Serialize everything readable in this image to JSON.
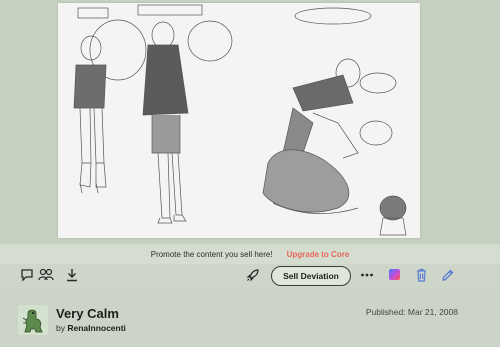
{
  "promo": {
    "text": "Promote the content you sell here!",
    "link": "Upgrade to Core"
  },
  "toolbar": {
    "sell_label": "Sell Deviation",
    "icons": [
      "comment-icon",
      "watchers-icon",
      "download-icon",
      "rocket-icon",
      "more-icon",
      "gradient-app-icon",
      "trash-icon",
      "edit-icon"
    ]
  },
  "deviation": {
    "title": "Very Calm",
    "by_prefix": "by",
    "author": "RenaInnocenti",
    "published": "Published: Mar 21, 2008"
  },
  "colors": {
    "accent_link": "#e8665a",
    "background": "#c9d3c4"
  }
}
